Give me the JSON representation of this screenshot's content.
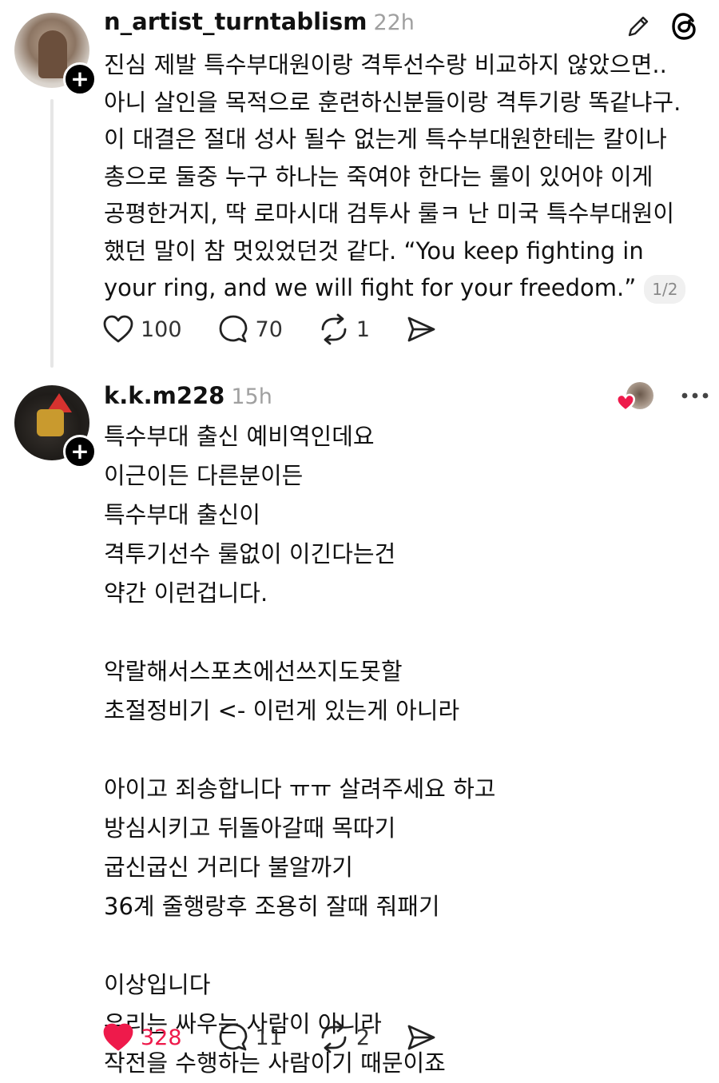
{
  "posts": [
    {
      "username": "n_artist_turntablism",
      "timestamp": "22h",
      "text": "진심 제발 특수부대원이랑 격투선수랑 비교하지 않았으면.. 아니 살인을 목적으로 훈련하신분들이랑 격투기랑 똑같냐구. 이 대결은 절대 성사 될수 없는게 특수부대원한테는 칼이나 총으로 둘중 누구 하나는 죽여야 한다는 룰이 있어야 이게 공평한거지, 딱 로마시대 검투사 룰ㅋ 난 미국 특수부대원이 했던 말이 참 멋있었던것 같다. “You keep fighting in your ring, and we will fight for your freedom.”",
      "page_indicator": "1/2",
      "likes": "100",
      "comments": "70",
      "reposts": "1",
      "icons": [
        "edit-pencil-icon",
        "threads-logo-icon",
        "heart-outline-icon",
        "comment-icon",
        "repost-icon",
        "share-send-icon"
      ]
    },
    {
      "username": "k.k.m228",
      "timestamp": "15h",
      "text": "특수부대 출신 예비역인데요\n이근이든 다른분이든\n특수부대 출신이\n격투기선수 룰없이 이긴다는건\n약간 이런겁니다.\n\n악랄해서스포츠에선쓰지도못할\n초절정비기 <- 이런게 있는게 아니라\n\n아이고 죄송합니다 ㅠㅠ 살려주세요 하고\n방심시키고 뒤돌아갈때 목따기\n굽신굽신 거리다 불알까기\n36계 줄행랑후 조용히 잘때 줘패기\n\n이상입니다\n우리는 싸우는 사람이 아니라\n작전을 수행하는 사람이기 때문이죠",
      "likes": "328",
      "liked": true,
      "comments": "11",
      "reposts": "2",
      "icons": [
        "liked-by-heart-icon",
        "more-options-icon",
        "heart-filled-icon",
        "comment-icon",
        "repost-icon",
        "share-send-icon"
      ]
    }
  ],
  "colors": {
    "liked_red": "#ee1a4b",
    "timestamp_gray": "#a0a0a0",
    "thread_line": "#e6e6e6"
  }
}
